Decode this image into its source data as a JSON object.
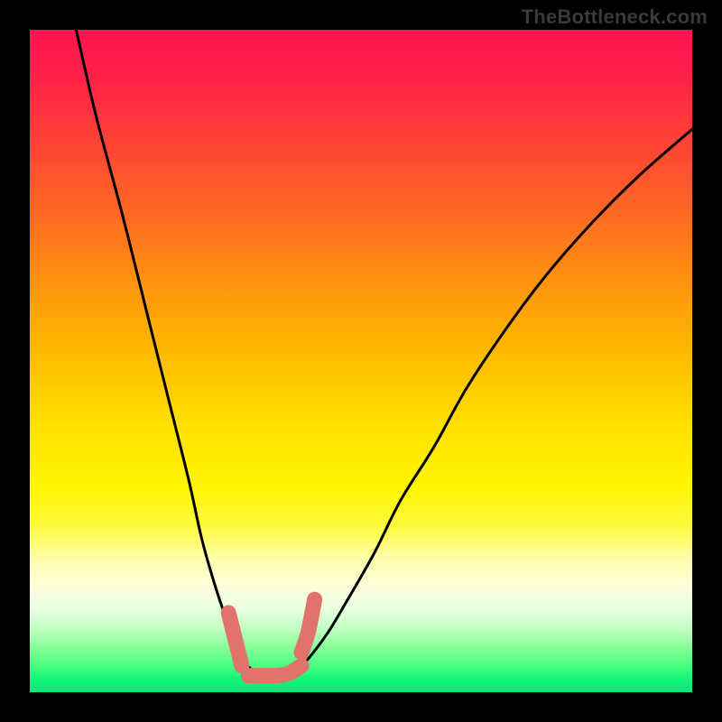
{
  "watermark": "TheBottleneck.com",
  "chart_data": {
    "type": "line",
    "title": "",
    "xlabel": "",
    "ylabel": "",
    "xlim": [
      0,
      100
    ],
    "ylim": [
      0,
      100
    ],
    "series": [
      {
        "name": "left-curve",
        "x": [
          7,
          10,
          14,
          18,
          21,
          24,
          26,
          28,
          30,
          31,
          32,
          34,
          36
        ],
        "values": [
          100,
          87,
          72,
          56,
          44,
          32,
          23,
          16,
          10,
          7,
          5,
          3,
          2
        ]
      },
      {
        "name": "right-curve",
        "x": [
          38,
          40,
          42,
          45,
          48,
          52,
          56,
          61,
          66,
          72,
          78,
          85,
          92,
          100
        ],
        "values": [
          2,
          3,
          5,
          9,
          14,
          21,
          29,
          37,
          46,
          55,
          63,
          71,
          78,
          85
        ]
      },
      {
        "name": "bottleneck-marker-left",
        "x": [
          30,
          31,
          32
        ],
        "values": [
          12,
          8,
          4
        ]
      },
      {
        "name": "bottleneck-marker-valley",
        "x": [
          33,
          35,
          37,
          39,
          41
        ],
        "values": [
          2.5,
          2.5,
          2.5,
          2.8,
          4
        ]
      },
      {
        "name": "bottleneck-marker-right",
        "x": [
          41,
          42,
          43
        ],
        "values": [
          6,
          9,
          14
        ]
      }
    ],
    "gradient_stops": [
      {
        "pos": 0,
        "color": "#ff1450"
      },
      {
        "pos": 47,
        "color": "#ffb400"
      },
      {
        "pos": 75,
        "color": "#fffa40"
      },
      {
        "pos": 100,
        "color": "#10e478"
      }
    ]
  }
}
